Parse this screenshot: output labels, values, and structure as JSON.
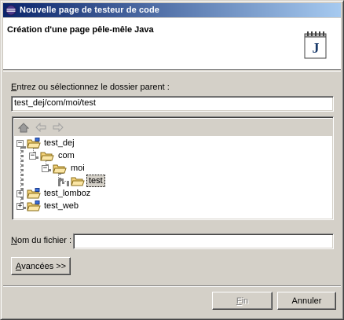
{
  "window": {
    "title": "Nouvelle page de testeur de code"
  },
  "banner": {
    "heading": "Création d'une page pêle-mêle Java",
    "icon_letter": "J"
  },
  "parent_folder": {
    "label_accel": "E",
    "label_rest": "ntrez ou sélectionnez le dossier parent :",
    "value": "test_dej/com/moi/test"
  },
  "tree_toolbar": {
    "icons": [
      "home-icon",
      "back-arrow-icon",
      "forward-arrow-icon"
    ]
  },
  "tree": {
    "nodes": [
      {
        "label": "test_dej",
        "expander": "−"
      },
      {
        "label": "com",
        "expander": "−"
      },
      {
        "label": "moi",
        "expander": "−"
      },
      {
        "label": "test",
        "expander": ""
      },
      {
        "label": "test_lomboz",
        "expander": "+"
      },
      {
        "label": "test_web",
        "expander": "+"
      }
    ]
  },
  "file_name": {
    "label_accel": "N",
    "label_rest": "om du fichier :",
    "value": ""
  },
  "buttons": {
    "advanced_accel": "A",
    "advanced_rest": "vancées >>",
    "finish_accel": "F",
    "finish_rest": "in",
    "cancel": "Annuler"
  },
  "colors": {
    "title_start": "#0a246a",
    "title_end": "#a6caf0",
    "face": "#d4d0c8",
    "folder": "#f4d27a"
  }
}
